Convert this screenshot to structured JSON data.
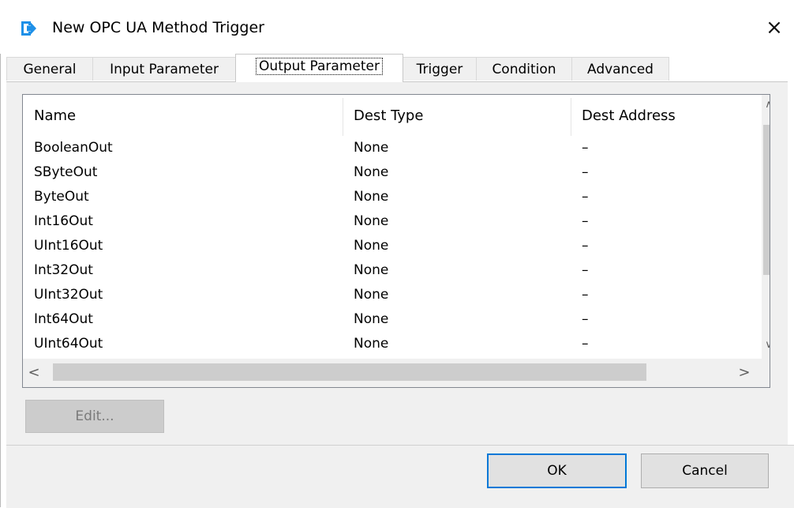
{
  "window": {
    "title": "New OPC UA Method Trigger",
    "close_glyph": "×",
    "icon": "login-arrow-icon",
    "accent": "#1e90e8"
  },
  "tabs": [
    {
      "label": "General"
    },
    {
      "label": "Input Parameter"
    },
    {
      "label": "Output Parameter",
      "active": true
    },
    {
      "label": "Trigger"
    },
    {
      "label": "Condition"
    },
    {
      "label": "Advanced"
    }
  ],
  "list": {
    "columns": [
      "Name",
      "Dest Type",
      "Dest Address"
    ],
    "rows": [
      {
        "name": "BooleanOut",
        "dest_type": "None",
        "dest_address": "–"
      },
      {
        "name": "SByteOut",
        "dest_type": "None",
        "dest_address": "–"
      },
      {
        "name": "ByteOut",
        "dest_type": "None",
        "dest_address": "–"
      },
      {
        "name": "Int16Out",
        "dest_type": "None",
        "dest_address": "–"
      },
      {
        "name": "UInt16Out",
        "dest_type": "None",
        "dest_address": "–"
      },
      {
        "name": "Int32Out",
        "dest_type": "None",
        "dest_address": "–"
      },
      {
        "name": "UInt32Out",
        "dest_type": "None",
        "dest_address": "–"
      },
      {
        "name": "Int64Out",
        "dest_type": "None",
        "dest_address": "–"
      },
      {
        "name": "UInt64Out",
        "dest_type": "None",
        "dest_address": "–"
      }
    ],
    "scroll": {
      "up": "∧",
      "down": "∨",
      "left": "<",
      "right": ">"
    }
  },
  "buttons": {
    "edit": "Edit...",
    "ok": "OK",
    "cancel": "Cancel"
  }
}
